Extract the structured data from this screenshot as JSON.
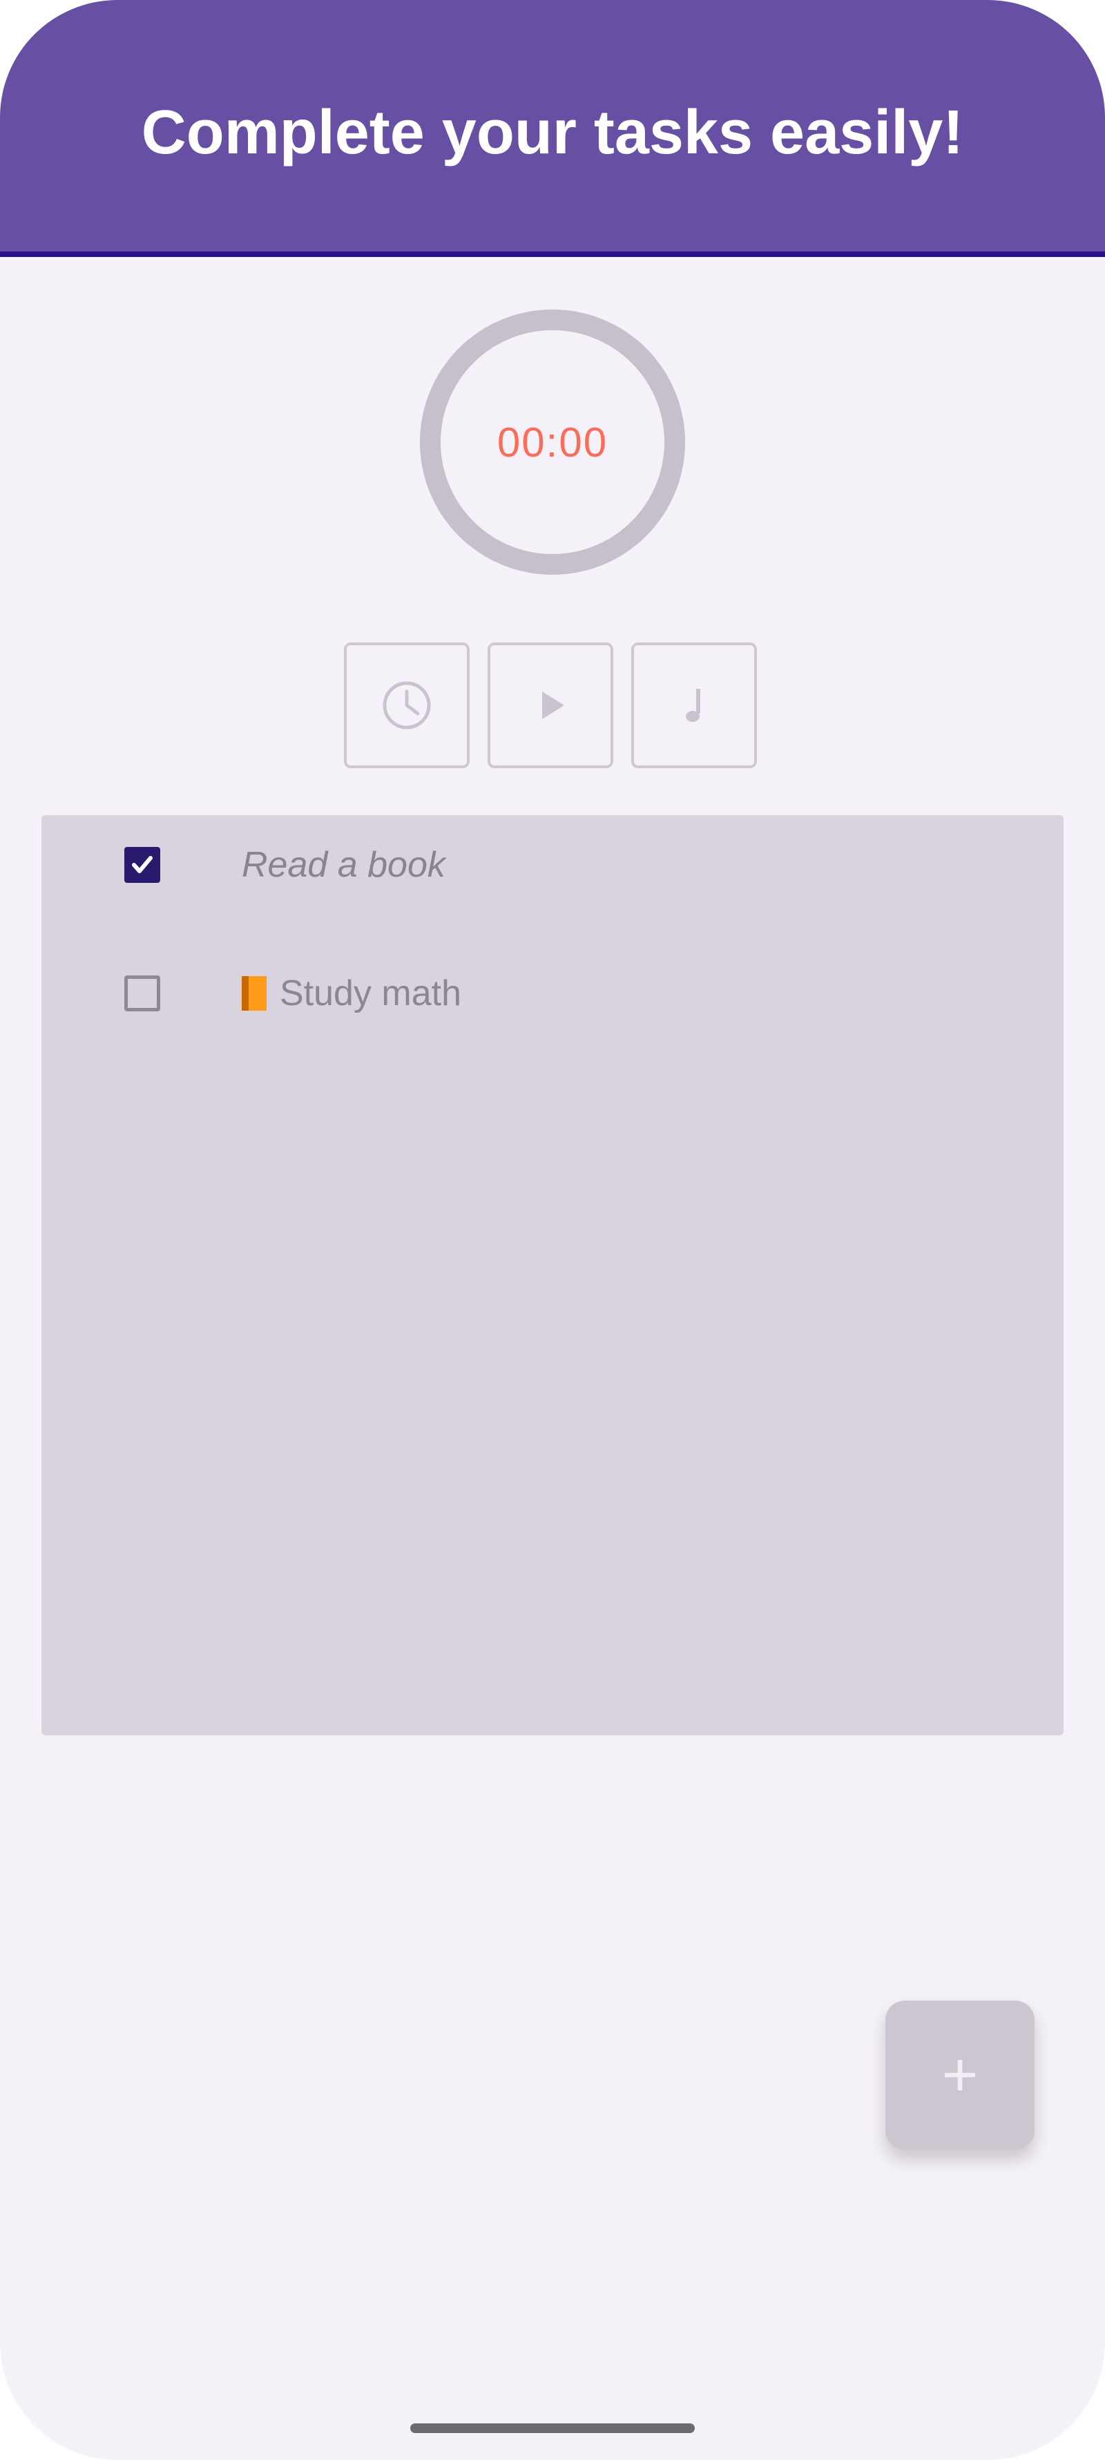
{
  "header": {
    "title": "Complete your tasks easily!"
  },
  "timer": {
    "display": "00:00"
  },
  "controls": [
    {
      "name": "clock-icon"
    },
    {
      "name": "play-icon"
    },
    {
      "name": "music-note-icon"
    }
  ],
  "tasks": [
    {
      "label": "Read a book",
      "done": true
    },
    {
      "label": "Study math",
      "done": false,
      "icon": "book-icon"
    }
  ],
  "fab": {
    "label": "+"
  },
  "colors": {
    "header_bg": "#6750a4",
    "header_border": "#2a0f8a",
    "background": "#f5f1f8",
    "timer_ring": "#c6c0cc",
    "timer_text": "#ff6b5a",
    "task_panel": "#d9d2df",
    "checkbox_checked": "#2a1a6e",
    "fab_bg": "#ccc6d1"
  }
}
